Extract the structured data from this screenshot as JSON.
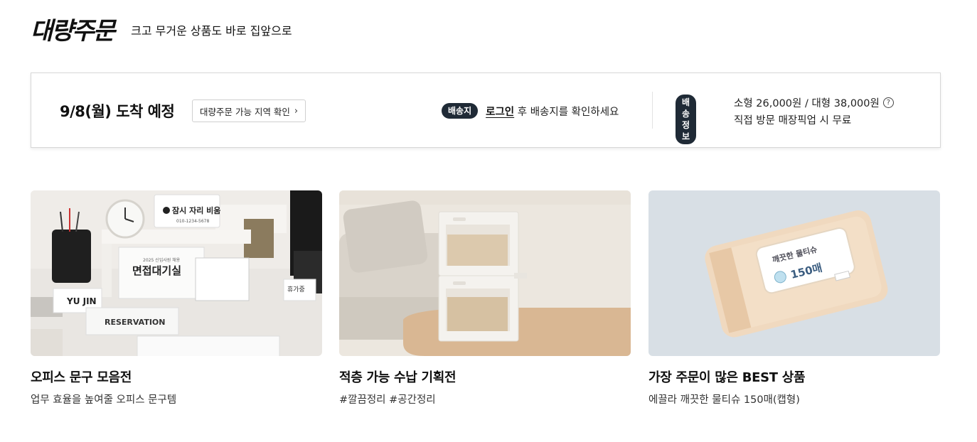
{
  "header": {
    "brand": "대량주문",
    "tagline": "크고 무거운 상품도 바로 집앞으로"
  },
  "delivery": {
    "arrival": "9/8(월) 도착 예정",
    "region_button": "대량주문 가능 지역 확인",
    "address_badge": "배송지",
    "login_link": "로그인",
    "address_prompt": "후 배송지를 확인하세요",
    "info_badge": "배송정보",
    "fee_text": "소형 26,000원 / 대형 38,000원",
    "pickup_text": "직접 방문 매장픽업 시 무료"
  },
  "cards": [
    {
      "title": "오피스 문구 모음전",
      "subtitle": "업무 효율을 높여줄 오피스 문구템",
      "image_text": {
        "sign": "잠시 자리 비움",
        "sign_phone": "010-1234-5678",
        "plaque_top": "2025 신입사원 채용",
        "plaque_main": "면접대기실",
        "nameplate": "YU JIN",
        "reservation": "RESERVATION",
        "small_tag": "휴가중"
      }
    },
    {
      "title": "적층 가능 수납 기획전",
      "subtitle": "#깔끔정리 #공간정리"
    },
    {
      "title": "가장 주문이 많은 BEST 상품",
      "subtitle": "에끌라 깨끗한 물티슈 150매(캡형)",
      "image_text": {
        "label": "깨끗한 물티슈",
        "count": "150매"
      }
    }
  ],
  "colors": {
    "badge_bg": "#1f2a36",
    "panel_border": "#d7d7d7"
  }
}
